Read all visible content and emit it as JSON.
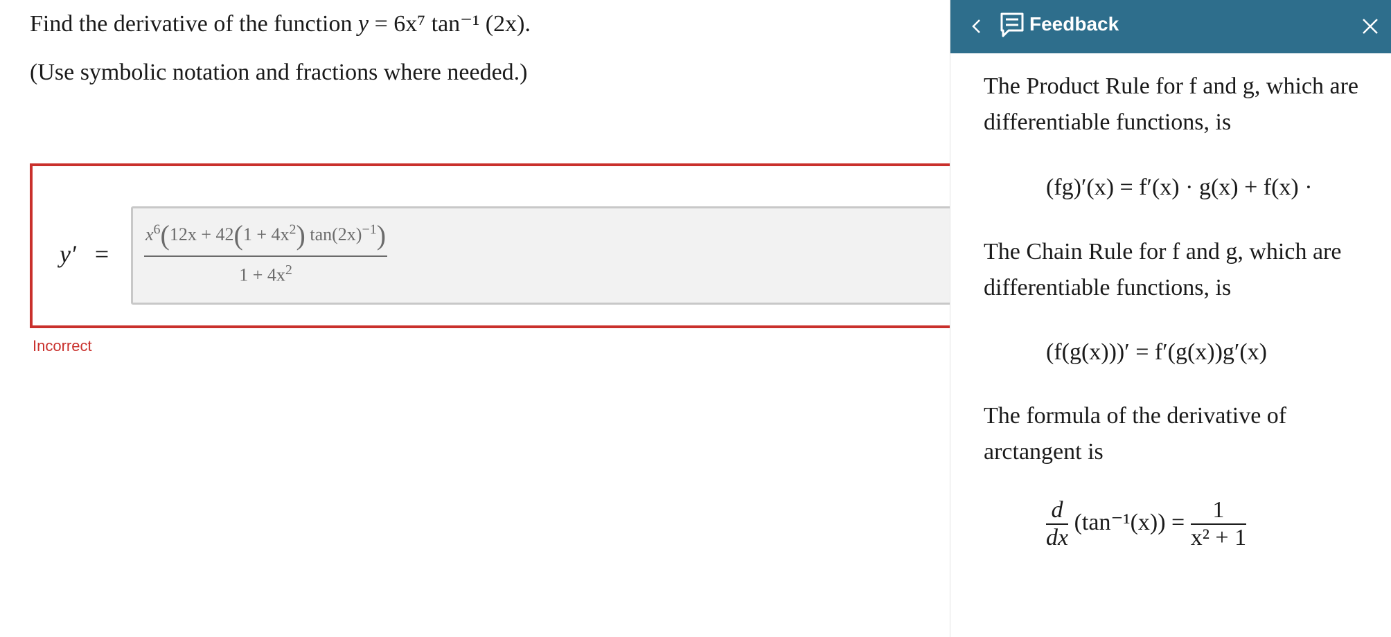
{
  "question": {
    "prompt": "Find the derivative of the function",
    "function_lhs": "y",
    "equals": "=",
    "function_rhs": "6x⁷ tan⁻¹ (2x).",
    "instruction": "(Use symbolic notation and fractions where needed.)"
  },
  "answer": {
    "lhs_label": "y′",
    "equals": "=",
    "numerator_factor": "x",
    "numerator_exp": "6",
    "numerator_inner": "12x + 42",
    "numerator_sub": "1 + 4x",
    "numerator_sub_exp": "2",
    "numerator_tail": "tan(2x)",
    "numerator_tail_exp": "−1",
    "denominator": "1 + 4x",
    "denominator_exp": "2"
  },
  "status": {
    "text": "Incorrect",
    "color": "#c9302c"
  },
  "feedback": {
    "title": "Feedback",
    "header_color": "#2e6e8c",
    "product_rule_text": "The Product Rule for f and g, which are differentiable functions, is",
    "product_rule_formula": "(fg)′(x) = f′(x) · g(x) + f(x) ·",
    "chain_rule_text": "The Chain Rule for f and g, which are differentiable functions, is",
    "chain_rule_formula": "(f(g(x)))′ = f′(g(x))g′(x)",
    "arctan_text": "The formula of the derivative of arctangent is",
    "arctan_formula_lhs_num": "d",
    "arctan_formula_lhs_den": "dx",
    "arctan_formula_middle": "(tan⁻¹(x)) =",
    "arctan_formula_rhs_num": "1",
    "arctan_formula_rhs_den": "x² + 1"
  }
}
